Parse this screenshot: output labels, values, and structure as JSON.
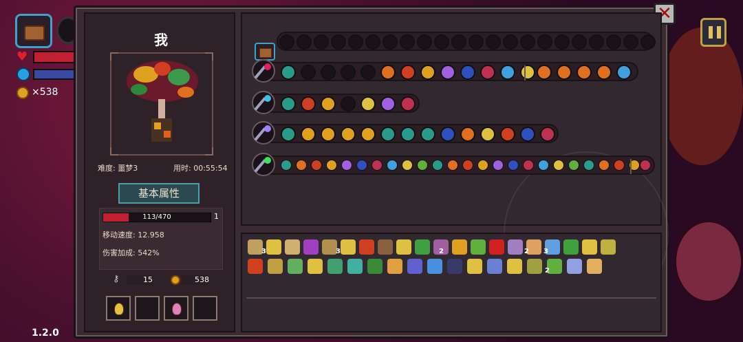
{
  "hud": {
    "coins_text": "×538",
    "version": "1.2.0"
  },
  "close_label": "✕",
  "player": {
    "name": "我",
    "difficulty": "难度: 噩梦3",
    "time": "用时: 00:55:54",
    "attr_tab": "基本属性",
    "hp_text": "113/470",
    "hp_fraction": 0.24,
    "level": "1",
    "move_speed": "移动速度: 12.958",
    "damage_bonus": "伤害加成: 542%",
    "keys": "15",
    "gold": "538"
  },
  "colors": {
    "accent": "#3fa2c8",
    "hp": "#c02030",
    "gold": "#e0a020",
    "panel": "#3a2a32"
  },
  "item_counts": [
    "3",
    "3",
    "2",
    "2",
    "3",
    "2"
  ]
}
